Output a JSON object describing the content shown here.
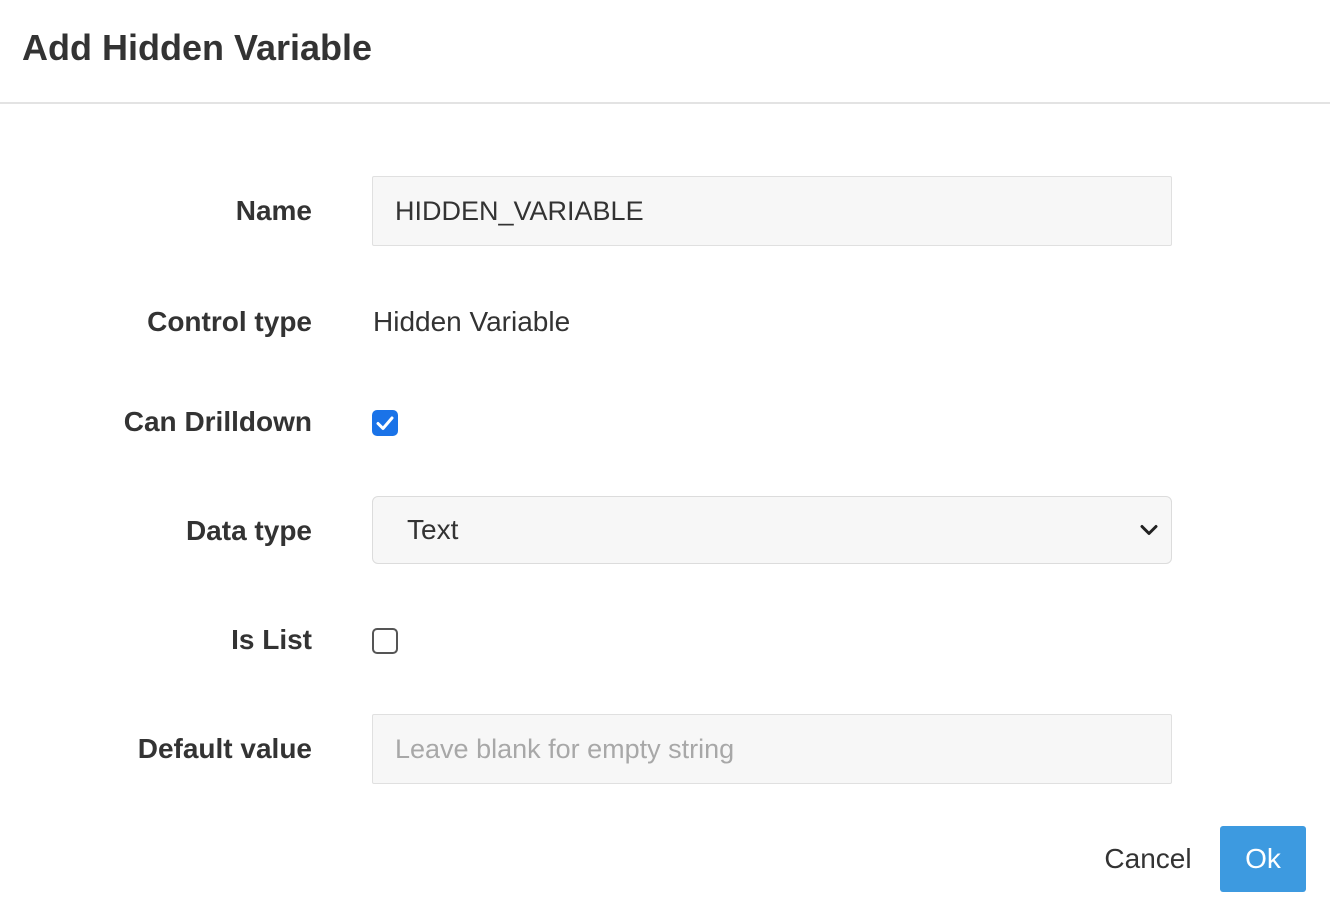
{
  "dialog": {
    "title": "Add Hidden Variable"
  },
  "form": {
    "name": {
      "label": "Name",
      "value": "HIDDEN_VARIABLE"
    },
    "control_type": {
      "label": "Control type",
      "value": "Hidden Variable"
    },
    "can_drilldown": {
      "label": "Can Drilldown",
      "checked": true
    },
    "data_type": {
      "label": "Data type",
      "selected": "Text",
      "icon": "chevron-down-icon"
    },
    "is_list": {
      "label": "Is List",
      "checked": false
    },
    "default_value": {
      "label": "Default value",
      "value": "",
      "placeholder": "Leave blank for empty string"
    }
  },
  "footer": {
    "cancel_label": "Cancel",
    "ok_label": "Ok"
  },
  "colors": {
    "primary_button": "#3d9ae0",
    "checkbox_checked": "#1a73e8",
    "input_background": "#f7f7f7",
    "text": "#333333",
    "placeholder": "#a8a8a8"
  }
}
